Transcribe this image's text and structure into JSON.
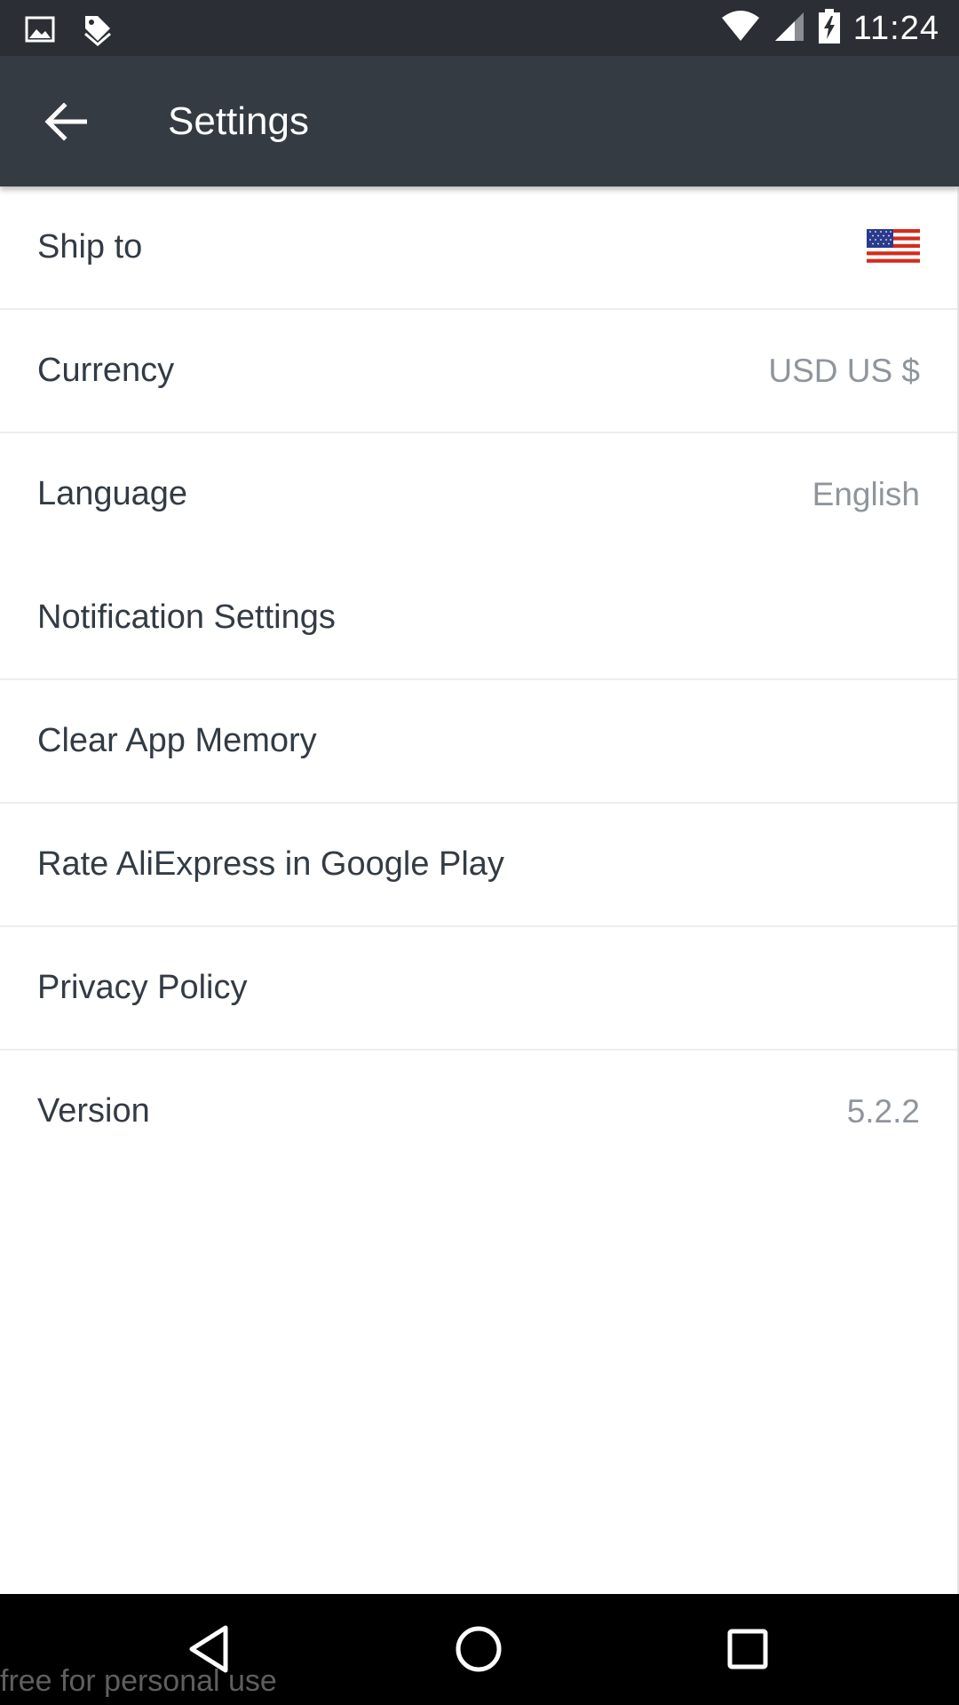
{
  "status_bar": {
    "time": "11:24",
    "left_icons": [
      "image-icon",
      "tag-icon"
    ],
    "right_icons": [
      "wifi-icon",
      "signal-icon",
      "battery-charging-icon"
    ]
  },
  "toolbar": {
    "title": "Settings",
    "back_icon": "arrow-back-icon"
  },
  "settings": {
    "items": [
      {
        "label": "Ship to",
        "value": "",
        "value_icon": "us-flag-icon"
      },
      {
        "label": "Currency",
        "value": "USD US $"
      },
      {
        "label": "Language",
        "value": "English"
      },
      {
        "label": "Notification Settings",
        "value": ""
      },
      {
        "label": "Clear App Memory",
        "value": ""
      },
      {
        "label": "Rate AliExpress in Google Play",
        "value": ""
      },
      {
        "label": "Privacy Policy",
        "value": ""
      },
      {
        "label": "Version",
        "value": "5.2.2"
      }
    ]
  },
  "nav_bar": {
    "icons": [
      "back-triangle-icon",
      "home-circle-icon",
      "recents-square-icon"
    ]
  },
  "watermark": "free for personal use",
  "colors": {
    "status_bar_bg": "#2b2f35",
    "toolbar_bg": "#353b43",
    "label_text": "#333b45",
    "value_text": "#8f959c",
    "divider": "#ededed"
  }
}
